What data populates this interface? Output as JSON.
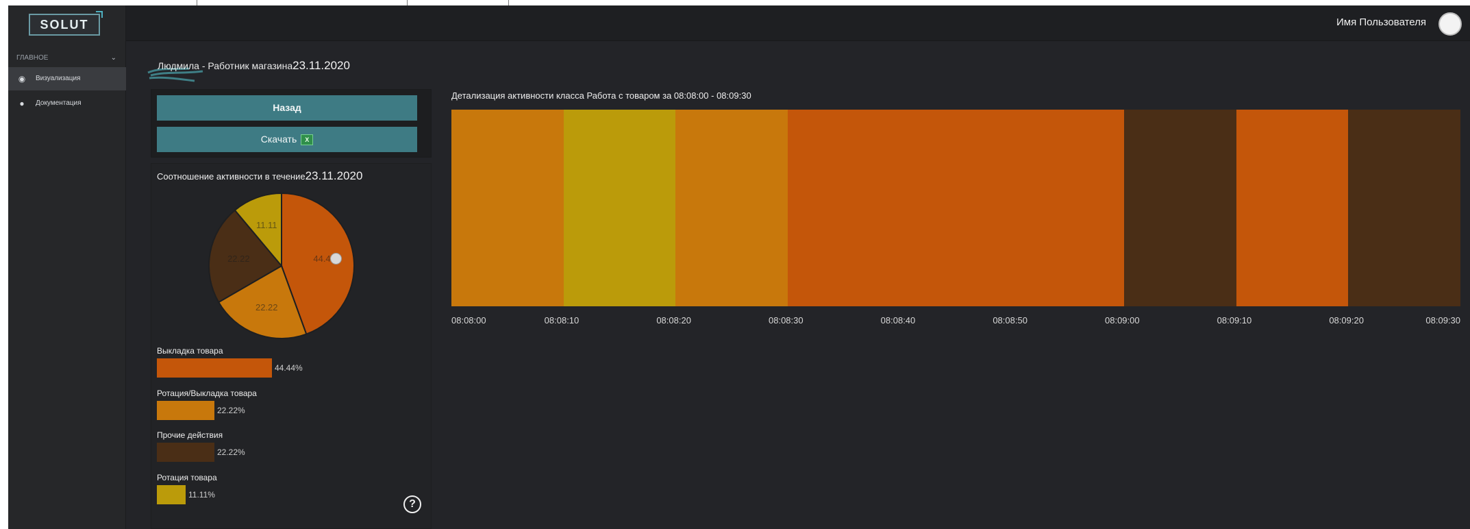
{
  "sidebar": {
    "logo": "SOLUT",
    "section": "ГЛАВНОЕ",
    "items": [
      {
        "label": "Визуализация",
        "icon": "eye-icon"
      },
      {
        "label": "Документация",
        "icon": "info-icon"
      }
    ]
  },
  "topbar": {
    "user_name": "Имя Пользователя"
  },
  "breadcrumb": {
    "text": "Людмила - Работник магазина",
    "date": "23.11.2020"
  },
  "buttons": {
    "back": "Назад",
    "download": "Скачать",
    "download_icon": "excel-icon"
  },
  "pie_panel": {
    "title": "Соотношение активности в течение",
    "date": "23.11.2020"
  },
  "timeline": {
    "title": "Детализация активности класса Работа с товаром за 08:08:00 - 08:09:30"
  },
  "colors": {
    "vykladka": "#c4560a",
    "rotaciya_vykladka": "#c8780c",
    "prochie": "#4a2e16",
    "rotaciya": "#bb9b0a",
    "accent_button": "#3e7b84"
  },
  "chart_data": [
    {
      "type": "pie",
      "title": "Соотношение активности в течение 23.11.2020",
      "slices": [
        {
          "name": "Выкладка товара",
          "value": 44.44,
          "label": "44.44",
          "legend_value": "44.44%",
          "color": "#c4560a"
        },
        {
          "name": "Ротация/Выкладка товара",
          "value": 22.22,
          "label": "22.22",
          "legend_value": "22.22%",
          "color": "#c8780c"
        },
        {
          "name": "Прочие действия",
          "value": 22.22,
          "label": "22.22",
          "legend_value": "22.22%",
          "color": "#4a2e16"
        },
        {
          "name": "Ротация товара",
          "value": 11.11,
          "label": "11.11",
          "legend_value": "11.11%",
          "color": "#bb9b0a"
        }
      ]
    },
    {
      "type": "bar",
      "title": "Детализация активности класса Работа с товаром за 08:08:00 - 08:09:30",
      "orientation": "horizontal-timeline",
      "x_range": [
        "08:08:00",
        "08:09:30"
      ],
      "ticks": [
        "08:08:00",
        "08:08:10",
        "08:08:20",
        "08:08:30",
        "08:08:40",
        "08:08:50",
        "08:09:00",
        "08:09:10",
        "08:09:20",
        "08:09:30"
      ],
      "segments": [
        {
          "start": "08:08:00",
          "end": "08:08:10",
          "activity": "Ротация/Выкладка товара",
          "color": "#c8780c"
        },
        {
          "start": "08:08:10",
          "end": "08:08:20",
          "activity": "Ротация товара",
          "color": "#bb9b0a"
        },
        {
          "start": "08:08:20",
          "end": "08:08:30",
          "activity": "Ротация/Выкладка товара",
          "color": "#c8780c"
        },
        {
          "start": "08:08:30",
          "end": "08:09:00",
          "activity": "Выкладка товара",
          "color": "#c4560a"
        },
        {
          "start": "08:09:00",
          "end": "08:09:10",
          "activity": "Прочие действия",
          "color": "#4a2e16"
        },
        {
          "start": "08:09:10",
          "end": "08:09:20",
          "activity": "Выкладка товара",
          "color": "#c4560a"
        },
        {
          "start": "08:09:20",
          "end": "08:09:30",
          "activity": "Прочие действия",
          "color": "#4a2e16"
        }
      ]
    }
  ]
}
